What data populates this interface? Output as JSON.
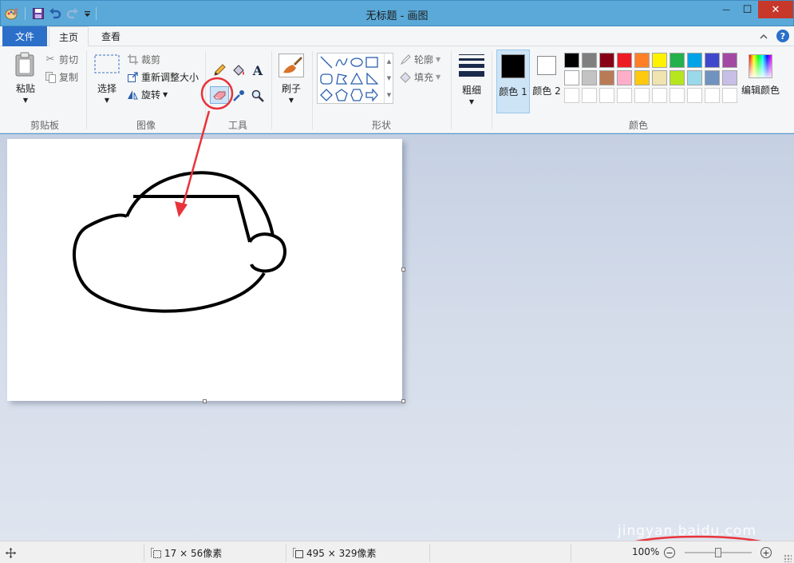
{
  "window": {
    "title": "无标题 - 画图",
    "minimize_glyph": "—",
    "maximize_glyph": "☐",
    "close_glyph": "✕"
  },
  "quick_access": {
    "icons": [
      "paint-app-icon",
      "save-icon",
      "undo-icon",
      "redo-icon",
      "customize-dropdown-icon"
    ]
  },
  "tabs": {
    "file": "文件",
    "home": "主页",
    "view": "查看"
  },
  "ribbon": {
    "clipboard": {
      "paste": "粘贴",
      "cut": "剪切",
      "copy": "复制",
      "label": "剪贴板"
    },
    "image": {
      "select": "选择",
      "crop": "裁剪",
      "resize": "重新调整大小",
      "rotate": "旋转",
      "label": "图像"
    },
    "tools": {
      "label": "工具",
      "text_glyph": "A"
    },
    "brushes": {
      "label": "刷子"
    },
    "shapes": {
      "outline": "轮廓",
      "fill": "填充",
      "label": "形状"
    },
    "size": {
      "label": "粗细"
    },
    "colors": {
      "color1": "颜色 1",
      "color2": "颜色 2",
      "edit": "编辑颜色",
      "label": "颜色",
      "color1_value": "#000000",
      "color2_value": "#ffffff",
      "palette_row1": [
        "#000000",
        "#7f7f7f",
        "#880015",
        "#ed1c24",
        "#ff7f27",
        "#fff200",
        "#22b14c",
        "#00a2e8",
        "#3f48cc",
        "#a349a4"
      ],
      "palette_row2": [
        "#ffffff",
        "#c3c3c3",
        "#b97a57",
        "#ffaec9",
        "#ffc90e",
        "#efe4b0",
        "#b5e61d",
        "#99d9ea",
        "#7092be",
        "#c8bfe7"
      ]
    }
  },
  "canvas": {
    "background": "#ffffff",
    "stroke_color": "#000000",
    "annotation_color": "#e8333a"
  },
  "status": {
    "selection_size": "17 × 56像素",
    "canvas_size": "495 × 329像素",
    "zoom": "100%",
    "zoom_fraction": 0.5
  },
  "watermark": "jingyan.baidu.com"
}
